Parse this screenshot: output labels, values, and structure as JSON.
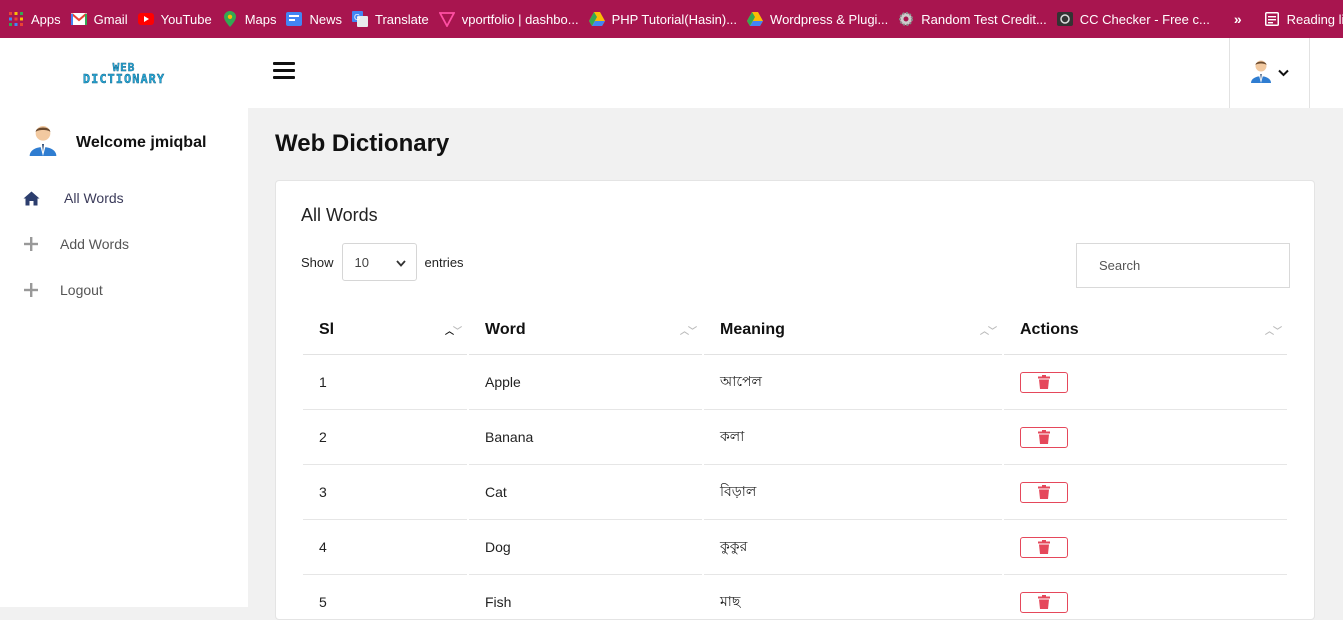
{
  "bookmarks": [
    {
      "label": "Apps",
      "icon": "apps-grid-icon"
    },
    {
      "label": "Gmail",
      "icon": "gmail-icon"
    },
    {
      "label": "YouTube",
      "icon": "youtube-icon"
    },
    {
      "label": "Maps",
      "icon": "maps-icon"
    },
    {
      "label": "News",
      "icon": "news-icon"
    },
    {
      "label": "Translate",
      "icon": "translate-icon"
    },
    {
      "label": "vportfolio | dashbo...",
      "icon": "vportfolio-icon"
    },
    {
      "label": "PHP Tutorial(Hasin)...",
      "icon": "drive-icon"
    },
    {
      "label": "Wordpress & Plugi...",
      "icon": "drive-icon"
    },
    {
      "label": "Random Test Credit...",
      "icon": "gear-icon"
    },
    {
      "label": "CC Checker - Free c...",
      "icon": "card-icon"
    }
  ],
  "bookmarks_more": "»",
  "reading_list": "Reading list",
  "logo": {
    "line1": "WEB",
    "line2": "DICTIONARY"
  },
  "sidebar": {
    "welcome": "Welcome jmiqbal",
    "items": [
      {
        "label": "All Words",
        "icon": "home-icon"
      },
      {
        "label": "Add Words",
        "icon": "plus-icon"
      },
      {
        "label": "Logout",
        "icon": "plus-icon"
      }
    ]
  },
  "main": {
    "page_title": "Web Dictionary",
    "card_title": "All Words",
    "show_label": "Show",
    "entries_value": "10",
    "entries_label": "entries",
    "search_placeholder": "Search",
    "columns": [
      "Sl",
      "Word",
      "Meaning",
      "Actions"
    ],
    "rows": [
      {
        "sl": "1",
        "word": "Apple",
        "meaning": "আপেল"
      },
      {
        "sl": "2",
        "word": "Banana",
        "meaning": "কলা"
      },
      {
        "sl": "3",
        "word": "Cat",
        "meaning": "বিড়াল"
      },
      {
        "sl": "4",
        "word": "Dog",
        "meaning": "কুকুর"
      },
      {
        "sl": "5",
        "word": "Fish",
        "meaning": "মাছ"
      }
    ]
  },
  "colors": {
    "bookmark_bar": "#a8154f",
    "delete": "#e5485b",
    "logo": "#29a9d6"
  }
}
